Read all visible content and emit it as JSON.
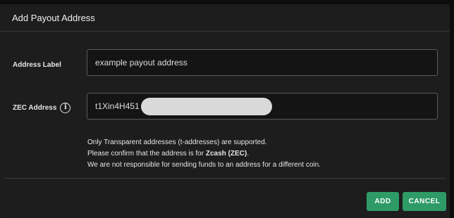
{
  "dialog": {
    "title": "Add Payout Address"
  },
  "form": {
    "address_label": {
      "label": "Address Label",
      "value": "example payout address"
    },
    "zec_address": {
      "label": "ZEC Address",
      "info_icon": "info-icon",
      "value_visible": "t1Xin4H451"
    }
  },
  "notes": {
    "line1": "Only Transparent addresses (t-addresses) are supported.",
    "line2_prefix": "Please confirm that the address is for ",
    "line2_bold": "Zcash (ZEC)",
    "line2_suffix": ".",
    "line3": "We are not responsible for sending funds to an address for a different coin."
  },
  "buttons": {
    "add": "ADD",
    "cancel": "CANCEL"
  },
  "colors": {
    "accent": "#2e9b67",
    "background": "#1d1d1d"
  }
}
